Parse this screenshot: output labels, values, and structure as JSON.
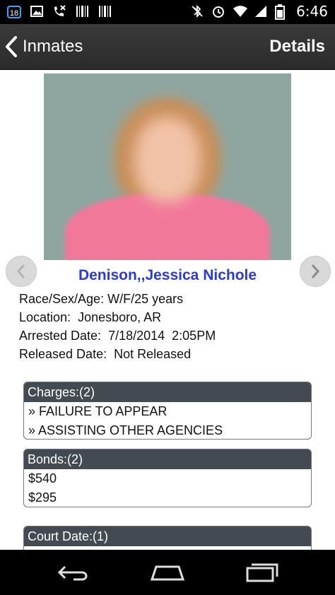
{
  "status_bar": {
    "notification_badge": "18",
    "time": "6:46",
    "icons_left": [
      "calendar-icon",
      "image-icon",
      "missed-call-icon",
      "barcode-icon",
      "barcode-icon"
    ],
    "icons_right": [
      "bluetooth-muted-icon",
      "alarm-icon",
      "wifi-icon",
      "signal-icon",
      "battery-icon"
    ]
  },
  "action_bar": {
    "back_label": "Inmates",
    "title": "Details"
  },
  "inmate": {
    "name": "Denison,,Jessica Nichole",
    "rows": [
      {
        "label": "Race/Sex/Age:",
        "value": "W/F/25 years"
      },
      {
        "label": "Location:",
        "value": "Jonesboro, AR"
      },
      {
        "label": "Arrested Date:",
        "value": "7/18/2014  2:05PM"
      },
      {
        "label": "Released Date:",
        "value": "Not Released"
      }
    ]
  },
  "charges": {
    "header": "Charges:(2)",
    "items": [
      "» FAILURE TO APPEAR",
      "» ASSISTING OTHER AGENCIES"
    ]
  },
  "bonds": {
    "header": "Bonds:(2)",
    "items": [
      "$540",
      "$295"
    ]
  },
  "court": {
    "header": "Court Date:(1)"
  },
  "colors": {
    "name_link": "#2c3ad9",
    "panel_header": "#444a52",
    "action_bar": "#333333"
  }
}
